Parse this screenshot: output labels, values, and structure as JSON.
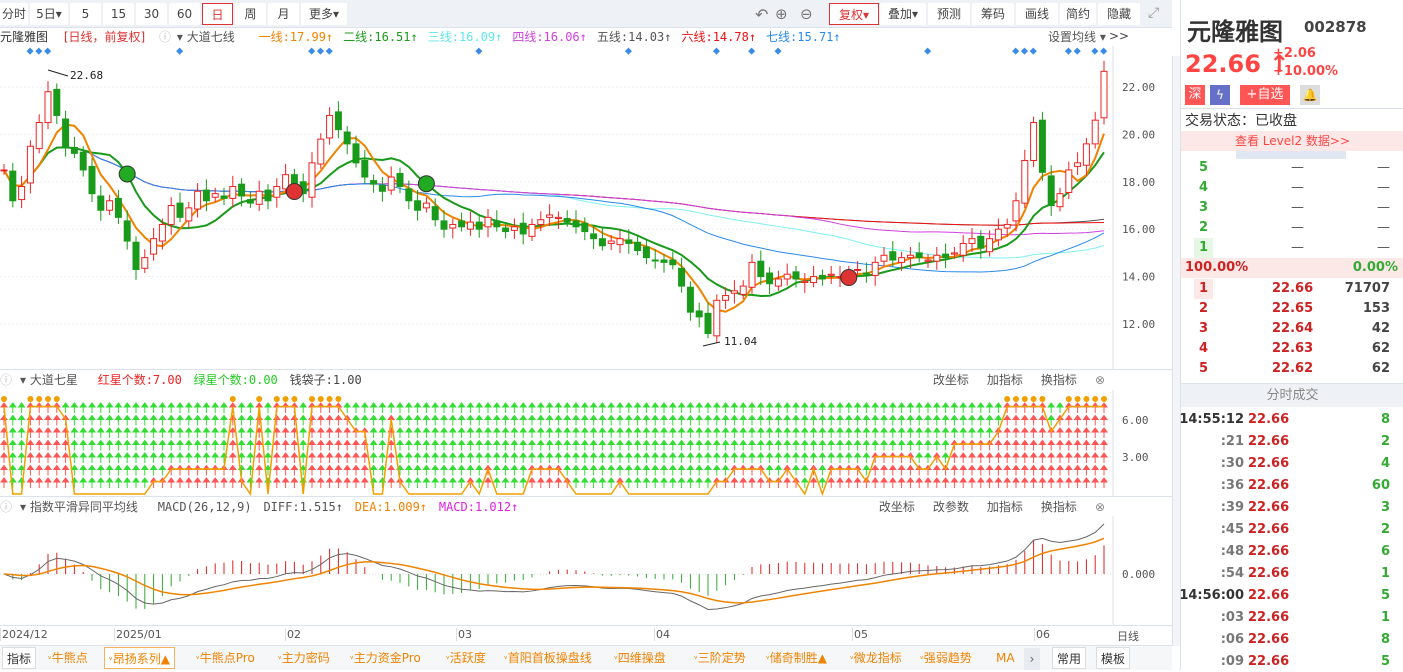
{
  "toolbar": {
    "periods": [
      "分时",
      "5日▾",
      "5",
      "15",
      "30",
      "60",
      "日",
      "周",
      "月",
      "更多▾"
    ],
    "active": "日",
    "right": [
      "复权▾",
      "叠加▾",
      "预测",
      "筹码",
      "画线",
      "简约",
      "隐藏>>"
    ]
  },
  "legend": {
    "name": "元隆雅图",
    "mode": "[日线，前复权]",
    "indicator": "大道七线",
    "lines": [
      {
        "label": "一线:17.99↑",
        "color": "#f08300"
      },
      {
        "label": "二线:16.51↑",
        "color": "#1a9a1a"
      },
      {
        "label": "三线:16.09↑",
        "color": "#5ee8e8"
      },
      {
        "label": "四线:16.06↑",
        "color": "#d040e0"
      },
      {
        "label": "五线:14.03↑",
        "color": "#555555"
      },
      {
        "label": "六线:14.78↑",
        "color": "#ee1111"
      },
      {
        "label": "七线:15.71↑",
        "color": "#2a8ae8"
      }
    ],
    "settings": "设置均线 ▾"
  },
  "main": {
    "high_label": "22.68",
    "low_label": "11.04",
    "y_ticks": [
      "22.00",
      "20.00",
      "18.00",
      "16.00",
      "14.00",
      "12.00"
    ]
  },
  "stars": {
    "title": "大道七星",
    "red": "红星个数:7.00",
    "green": "绿星个数:0.00",
    "bag": "钱袋子:1.00",
    "buttons": [
      "改坐标",
      "加指标",
      "换指标"
    ],
    "y_ticks": [
      "6.00",
      "3.00"
    ]
  },
  "macd": {
    "title": "指数平滑异同平均线",
    "params": "MACD(26,12,9)",
    "diff": "DIFF:1.515↑",
    "dea": "DEA:1.009↑",
    "macd": "MACD:1.012↑",
    "buttons": [
      "改坐标",
      "改参数",
      "加指标",
      "换指标"
    ],
    "y_tick": "0.000"
  },
  "x_axis": {
    "labels": [
      "2024/12",
      "2025/01",
      "02",
      "03",
      "04",
      "05",
      "06"
    ],
    "unit": "日线"
  },
  "bottom_tabs": [
    "指标",
    "牛熊点",
    "昂扬系列▲",
    "牛熊点Pro",
    "主力密码",
    "主力资金Pro",
    "活跃度",
    "首阳首板操盘线",
    "四维操盘",
    "三阶定势",
    "储奇制胜▲",
    "微龙指标",
    "强弱趋势",
    "MA"
  ],
  "bottom_right": [
    "常用",
    "模板"
  ],
  "quote": {
    "name": "元隆雅图",
    "code": "002878",
    "price": "22.66",
    "change": "+2.06",
    "pct": "+10.00%",
    "badges": {
      "market": "深",
      "add": "+自选"
    },
    "status": "交易状态：已收盘",
    "level2": "查看 Level2 数据>>",
    "asks": [
      {
        "n": "5",
        "p": "—",
        "v": "—"
      },
      {
        "n": "4",
        "p": "—",
        "v": "—"
      },
      {
        "n": "3",
        "p": "—",
        "v": "—"
      },
      {
        "n": "2",
        "p": "—",
        "v": "—"
      },
      {
        "n": "1",
        "p": "—",
        "v": "—"
      }
    ],
    "ratio_left": "100.00%",
    "ratio_right": "0.00%",
    "bids": [
      {
        "n": "1",
        "p": "22.66",
        "v": "71707"
      },
      {
        "n": "2",
        "p": "22.65",
        "v": "153"
      },
      {
        "n": "3",
        "p": "22.64",
        "v": "42"
      },
      {
        "n": "4",
        "p": "22.63",
        "v": "62"
      },
      {
        "n": "5",
        "p": "22.62",
        "v": "62"
      }
    ],
    "ticks_title": "分时成交",
    "ticks": [
      {
        "t": "14:55:12",
        "p": "22.66",
        "v": "8"
      },
      {
        "t": ":21",
        "p": "22.66",
        "v": "2"
      },
      {
        "t": ":30",
        "p": "22.66",
        "v": "4"
      },
      {
        "t": ":36",
        "p": "22.66",
        "v": "60"
      },
      {
        "t": ":39",
        "p": "22.66",
        "v": "3"
      },
      {
        "t": ":45",
        "p": "22.66",
        "v": "2"
      },
      {
        "t": ":48",
        "p": "22.66",
        "v": "6"
      },
      {
        "t": ":54",
        "p": "22.66",
        "v": "1"
      },
      {
        "t": "14:56:00",
        "p": "22.66",
        "v": "5"
      },
      {
        "t": ":03",
        "p": "22.66",
        "v": "1"
      },
      {
        "t": ":06",
        "p": "22.66",
        "v": "8"
      },
      {
        "t": ":09",
        "p": "22.66",
        "v": "5"
      }
    ]
  },
  "colors": {
    "up": "#ee2222",
    "down": "#1a9a1a",
    "accent": "#d33"
  },
  "chart_data": {
    "type": "candlestick",
    "ylim": [
      10.5,
      23.5
    ],
    "close": [
      18.5,
      17.2,
      17.8,
      19.5,
      20.5,
      21.8,
      20.8,
      19.5,
      19.2,
      18.5,
      17.5,
      16.8,
      17.2,
      16.5,
      15.5,
      14.3,
      14.8,
      15.6,
      16.2,
      17.0,
      16.5,
      16.9,
      17.6,
      17.2,
      17.5,
      17.3,
      17.8,
      17.4,
      17.1,
      17.6,
      17.2,
      17.8,
      18.3,
      17.9,
      17.5,
      18.8,
      19.8,
      20.8,
      20.2,
      19.6,
      18.8,
      18.2,
      17.9,
      17.6,
      18.2,
      17.8,
      17.2,
      16.8,
      17.1,
      16.4,
      16.0,
      16.2,
      16.1,
      16.3,
      16.0,
      16.5,
      16.1,
      15.9,
      16.1,
      15.8,
      16.2,
      16.4,
      16.6,
      16.5,
      16.3,
      16.1,
      15.9,
      15.6,
      15.3,
      15.5,
      15.6,
      15.4,
      15.1,
      14.8,
      14.7,
      14.6,
      14.5,
      13.6,
      12.5,
      12.3,
      11.6,
      13.0,
      13.2,
      13.4,
      13.6,
      14.6,
      14.0,
      13.7,
      13.9,
      14.1,
      13.9,
      13.8,
      14.0,
      13.9,
      14.1,
      14.0,
      14.2,
      14.3,
      14.1,
      14.6,
      14.9,
      14.7,
      14.8,
      14.9,
      14.8,
      14.7,
      14.9,
      14.8,
      15.0,
      15.4,
      15.6,
      15.2,
      15.6,
      16.0,
      16.2,
      17.2,
      18.9,
      20.5,
      18.4,
      17.0,
      17.5,
      18.5,
      18.8,
      19.6,
      20.6,
      22.66
    ]
  }
}
